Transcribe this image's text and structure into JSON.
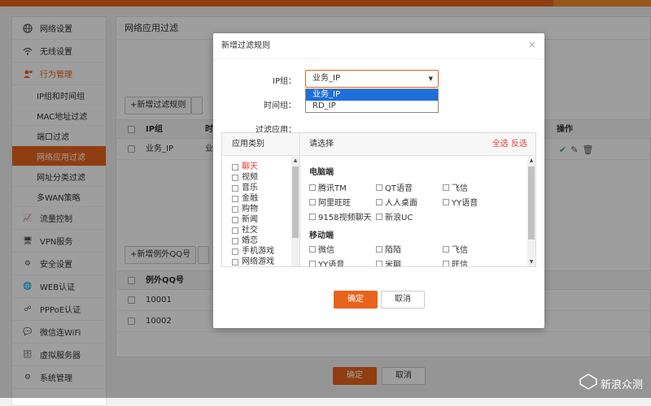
{
  "colors": {
    "accent": "#e8631c",
    "link_red": "#e53935",
    "selected_blue": "#1e6fd9"
  },
  "sidebar": {
    "items": [
      {
        "label": "网络设置",
        "icon": "globe-icon"
      },
      {
        "label": "无线设置",
        "icon": "wifi-icon"
      },
      {
        "label": "行为管理",
        "icon": "user-manage-icon"
      }
    ],
    "sub_items": [
      "IP组和时间组",
      "MAC地址过滤",
      "端口过滤",
      "网络应用过滤",
      "网址分类过滤",
      "多WAN策略"
    ],
    "active_sub": "网络应用过滤",
    "items_after": [
      {
        "label": "流量控制",
        "icon": "chart-icon"
      },
      {
        "label": "VPN服务",
        "icon": "monitor-icon"
      },
      {
        "label": "安全设置",
        "icon": "gear-icon"
      },
      {
        "label": "WEB认证",
        "icon": "web-icon"
      },
      {
        "label": "PPPoE认证",
        "icon": "network-icon"
      },
      {
        "label": "微信连WiFi",
        "icon": "wechat-icon"
      },
      {
        "label": "虚拟服务器",
        "icon": "server-icon"
      },
      {
        "label": "系统管理",
        "icon": "settings-icon"
      }
    ]
  },
  "main": {
    "title": "网络应用过滤",
    "add_rule_button": "+新增过滤规则",
    "rules_table": {
      "headers": {
        "ip_group": "IP组",
        "time": "时",
        "operation": "操作"
      },
      "rows": [
        {
          "ip_group": "业务_IP",
          "time": "业"
        }
      ]
    },
    "add_qq_button": "+新增例外QQ号",
    "qq_table": {
      "header": "例外QQ号",
      "rows": [
        "10001",
        "10002"
      ]
    },
    "ok_button": "确定",
    "cancel_button": "取消"
  },
  "modal": {
    "title": "新增过滤规则",
    "close": "×",
    "ip_group_label": "IP组：",
    "ip_group_value": "业务_IP",
    "ip_group_options": [
      "业务_IP",
      "RD_IP"
    ],
    "time_group_label": "时间组：",
    "filter_app_label": "过滤应用：",
    "category_header": "应用类别",
    "select_header": "请选择",
    "select_all": "全选",
    "invert": "反选",
    "categories": [
      "聊天",
      "视频",
      "音乐",
      "金融",
      "购物",
      "新闻",
      "社交",
      "婚恋",
      "手机游戏",
      "网络游戏"
    ],
    "highlighted_category": "聊天",
    "pc_section": "电脑端",
    "pc_apps": [
      "腾讯TM",
      "QT语音",
      "飞信",
      "阿里旺旺",
      "人人桌面",
      "YY语音",
      "9158视频聊天",
      "新浪UC"
    ],
    "mobile_section": "移动端",
    "mobile_apps": [
      "微信",
      "陌陌",
      "飞信",
      "YY语音",
      "米聊",
      "旺信"
    ],
    "ok_button": "确定",
    "cancel_button": "取消"
  },
  "watermark": "新浪众测"
}
